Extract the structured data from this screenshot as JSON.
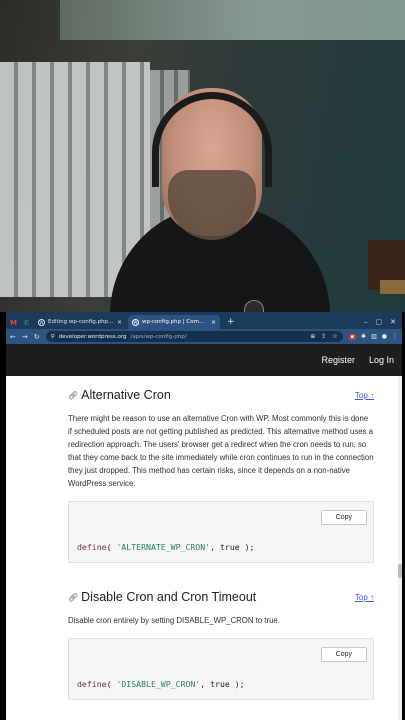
{
  "tabs": [
    {
      "label": "Editing wp-config.php – Word",
      "close": "×"
    },
    {
      "label": "wp-config.php | Common APIs",
      "close": "×"
    }
  ],
  "new_tab": "+",
  "address": {
    "host": "developer.wordpress.org",
    "path": "/apis/wp-config-php/"
  },
  "site_nav": {
    "register": "Register",
    "login": "Log In"
  },
  "sections": [
    {
      "title": "Alternative Cron",
      "top_link": "Top ↑",
      "text": "There might be reason to use an alternative Cron with WP. Most commonly this is done if scheduled posts are not getting published as predicted. This alternative method uses a redirection approach. The users' browser get a redirect when the cron needs to run, so that they come back to the site immediately while cron continues to run in the connection they just dropped. This method has certain risks, since it depends on a non-native WordPress service.",
      "copy_label": "Copy",
      "code": {
        "fn": "define",
        "open": "( ",
        "str": "'ALTERNATE_WP_CRON'",
        "rest": ", true );"
      }
    },
    {
      "title": "Disable Cron and Cron Timeout",
      "top_link": "Top ↑",
      "text": "Disable cron entirely by setting DISABLE_WP_CRON to true.",
      "copy_label": "Copy",
      "code": {
        "fn": "define",
        "open": "( ",
        "str": "'DISABLE_WP_CRON'",
        "rest": ", true );"
      }
    }
  ],
  "colors": {
    "tabbar": "#1c3a5c",
    "toolbar": "#2d5380",
    "link": "#3858e9",
    "site_header": "#1e1e1e"
  },
  "icons": [
    "gmail-icon",
    "phone-icon",
    "wordpress-icon",
    "back-arrow-icon",
    "forward-arrow-icon",
    "reload-icon",
    "site-info-icon",
    "zoom-icon",
    "share-icon",
    "bookmark-star-icon",
    "extensions-icon",
    "profile-icon",
    "menu-icon",
    "link-icon"
  ]
}
